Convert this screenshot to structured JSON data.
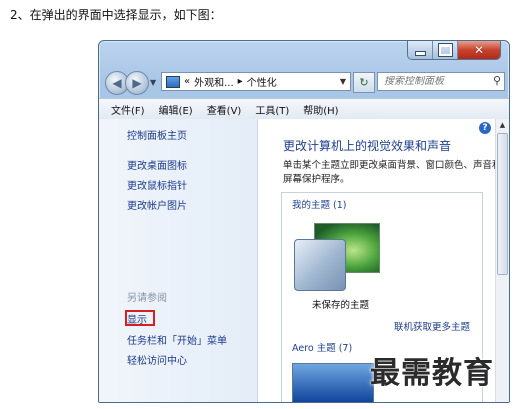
{
  "document": {
    "heading": "2、在弹出的界面中选择显示，如下图："
  },
  "window": {
    "address": {
      "path_prefix": "«",
      "segment_1": "外观和...",
      "separator": "▸",
      "segment_2": "个性化"
    },
    "search": {
      "placeholder": "搜索控制面板"
    },
    "menu": [
      "文件(F)",
      "编辑(E)",
      "查看(V)",
      "工具(T)",
      "帮助(H)"
    ],
    "sidebar": {
      "home": "控制面板主页",
      "links": [
        "更改桌面图标",
        "更改鼠标指针",
        "更改帐户图片"
      ],
      "see_also": "另请参阅",
      "see_also_links": [
        "显示",
        "任务栏和「开始」菜单",
        "轻松访问中心"
      ]
    },
    "main": {
      "title": "更改计算机上的视觉效果和声音",
      "description": "单击某个主题立即更改桌面背景、窗口颜色、声音和屏幕保护程序。",
      "my_themes": "我的主题 (1)",
      "unsaved_theme": "未保存的主题",
      "online_link": "联机获取更多主题",
      "aero_themes": "Aero 主题 (7)"
    }
  },
  "watermark": "最需教育",
  "colors": {
    "highlight_box": "#d42020",
    "link": "#1c3a8c"
  }
}
